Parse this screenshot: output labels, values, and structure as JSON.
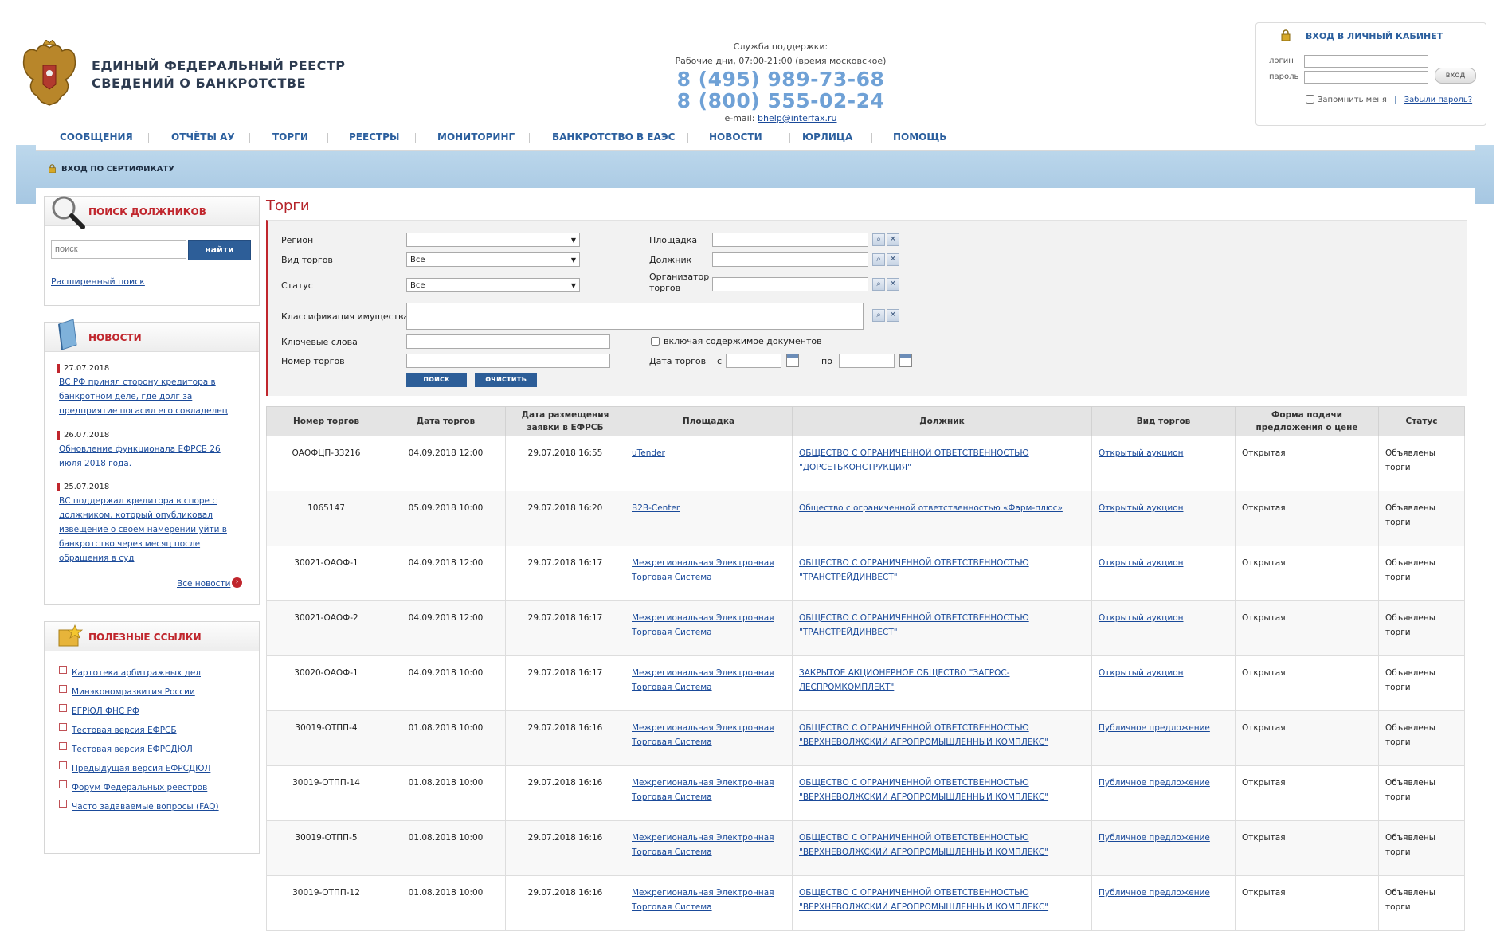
{
  "header": {
    "title_line1": "ЕДИНЫЙ ФЕДЕРАЛЬНЫЙ РЕЕСТР",
    "title_line2": "СВЕДЕНИЙ О БАНКРОТСТВЕ",
    "support_label": "Служба поддержки:",
    "support_hours": "Рабочие дни, 07:00-21:00 (время московское)",
    "phone1": "8 (495) 989-73-68",
    "phone2": "8 (800) 555-02-24",
    "email_label": "e-mail:",
    "email": "bhelp@interfax.ru"
  },
  "login": {
    "title": "ВХОД В ЛИЧНЫЙ КАБИНЕТ",
    "login_label": "логин",
    "password_label": "пароль",
    "submit": "вход",
    "remember": "Запомнить меня",
    "separator": "|",
    "forgot": "Забыли пароль?"
  },
  "nav": {
    "items": [
      "СООБЩЕНИЯ",
      "ОТЧЁТЫ АУ",
      "ТОРГИ",
      "РЕЕСТРЫ",
      "МОНИТОРИНГ",
      "БАНКРОТСТВО В ЕАЭС",
      "НОВОСТИ",
      "ЮРЛИЦА",
      "ПОМОЩЬ"
    ]
  },
  "cert_login": "ВХОД ПО СЕРТИФИКАТУ",
  "sidebar": {
    "search": {
      "title": "ПОИСК ДОЛЖНИКОВ",
      "placeholder": "поиск",
      "button": "найти",
      "advanced": "Расширенный поиск"
    },
    "news": {
      "title": "НОВОСТИ",
      "items": [
        {
          "date": "27.07.2018",
          "text": "ВС РФ принял сторону кредитора в банкротном деле, где долг за предприятие погасил его совладелец"
        },
        {
          "date": "26.07.2018",
          "text": "Обновление функционала ЕФРСБ 26 июля 2018 года."
        },
        {
          "date": "25.07.2018",
          "text": "ВС поддержал кредитора в споре с должником, который опубликовал извещение о своем намерении уйти в банкротство через месяц после обращения в суд"
        }
      ],
      "all": "Все новости"
    },
    "links": {
      "title": "ПОЛЕЗНЫЕ ССЫЛКИ",
      "items": [
        "Картотека арбитражных дел",
        "Минэкономразвития России",
        "ЕГРЮЛ ФНС РФ",
        "Тестовая версия ЕФРСБ",
        "Тестовая версия ЕФРСДЮЛ",
        "Предыдущая версия ЕФРСДЮЛ",
        "Форум Федеральных реестров",
        "Часто задаваемые вопросы (FAQ)"
      ]
    }
  },
  "main": {
    "title": "Торги",
    "filters": {
      "region_label": "Регион",
      "region_value": "",
      "type_label": "Вид торгов",
      "type_value": "Все",
      "status_label": "Статус",
      "status_value": "Все",
      "classification_label": "Классификация имущества",
      "keywords_label": "Ключевые слова",
      "number_label": "Номер торгов",
      "platform_label": "Площадка",
      "debtor_label": "Должник",
      "organizer_label_1": "Организатор",
      "organizer_label_2": "торгов",
      "include_docs": "включая содержимое документов",
      "date_label": "Дата торгов",
      "date_from": "с",
      "date_to": "по",
      "search_btn": "поиск",
      "clear_btn": "очистить"
    },
    "table": {
      "columns": [
        "Номер торгов",
        "Дата торгов",
        "Дата размещения заявки в ЕФРСБ",
        "Площадка",
        "Должник",
        "Вид торгов",
        "Форма подачи предложения о цене",
        "Статус"
      ],
      "rows": [
        [
          "ОАОФЦП-33216",
          "04.09.2018 12:00",
          "29.07.2018 16:55",
          "uTender",
          "ОБЩЕСТВО С ОГРАНИЧЕННОЙ ОТВЕТСТВЕННОСТЬЮ \"ДОРСЕТЬКОНСТРУКЦИЯ\"",
          "Открытый аукцион",
          "Открытая",
          "Объявлены торги"
        ],
        [
          "1065147",
          "05.09.2018 10:00",
          "29.07.2018 16:20",
          "B2B-Center",
          "Общество с ограниченной ответственностью «Фарм-плюс»",
          "Открытый аукцион",
          "Открытая",
          "Объявлены торги"
        ],
        [
          "30021-ОАОФ-1",
          "04.09.2018 12:00",
          "29.07.2018 16:17",
          "Межрегиональная Электронная Торговая Система",
          "ОБЩЕСТВО С ОГРАНИЧЕННОЙ ОТВЕТСТВЕННОСТЬЮ \"ТРАНСТРЕЙДИНВЕСТ\"",
          "Открытый аукцион",
          "Открытая",
          "Объявлены торги"
        ],
        [
          "30021-ОАОФ-2",
          "04.09.2018 12:00",
          "29.07.2018 16:17",
          "Межрегиональная Электронная Торговая Система",
          "ОБЩЕСТВО С ОГРАНИЧЕННОЙ ОТВЕТСТВЕННОСТЬЮ \"ТРАНСТРЕЙДИНВЕСТ\"",
          "Открытый аукцион",
          "Открытая",
          "Объявлены торги"
        ],
        [
          "30020-ОАОФ-1",
          "04.09.2018 10:00",
          "29.07.2018 16:17",
          "Межрегиональная Электронная Торговая Система",
          "ЗАКРЫТОЕ АКЦИОНЕРНОЕ ОБЩЕСТВО \"ЗАГРОС-ЛЕСПРОМКОМПЛЕКТ\"",
          "Открытый аукцион",
          "Открытая",
          "Объявлены торги"
        ],
        [
          "30019-ОТПП-4",
          "01.08.2018 10:00",
          "29.07.2018 16:16",
          "Межрегиональная Электронная Торговая Система",
          "ОБЩЕСТВО С ОГРАНИЧЕННОЙ ОТВЕТСТВЕННОСТЬЮ \"ВЕРХНЕВОЛЖСКИЙ АГРОПРОМЫШЛЕННЫЙ КОМПЛЕКС\"",
          "Публичное предложение",
          "Открытая",
          "Объявлены торги"
        ],
        [
          "30019-ОТПП-14",
          "01.08.2018 10:00",
          "29.07.2018 16:16",
          "Межрегиональная Электронная Торговая Система",
          "ОБЩЕСТВО С ОГРАНИЧЕННОЙ ОТВЕТСТВЕННОСТЬЮ \"ВЕРХНЕВОЛЖСКИЙ АГРОПРОМЫШЛЕННЫЙ КОМПЛЕКС\"",
          "Публичное предложение",
          "Открытая",
          "Объявлены торги"
        ],
        [
          "30019-ОТПП-5",
          "01.08.2018 10:00",
          "29.07.2018 16:16",
          "Межрегиональная Электронная Торговая Система",
          "ОБЩЕСТВО С ОГРАНИЧЕННОЙ ОТВЕТСТВЕННОСТЬЮ \"ВЕРХНЕВОЛЖСКИЙ АГРОПРОМЫШЛЕННЫЙ КОМПЛЕКС\"",
          "Публичное предложение",
          "Открытая",
          "Объявлены торги"
        ],
        [
          "30019-ОТПП-12",
          "01.08.2018 10:00",
          "29.07.2018 16:16",
          "Межрегиональная Электронная Торговая Система",
          "ОБЩЕСТВО С ОГРАНИЧЕННОЙ ОТВЕТСТВЕННОСТЬЮ \"ВЕРХНЕВОЛЖСКИЙ АГРОПРОМЫШЛЕННЫЙ КОМПЛЕКС\"",
          "Публичное предложение",
          "Открытая",
          "Объявлены торги"
        ]
      ]
    }
  },
  "colors": {
    "accent_red": "#c0262d",
    "nav_blue": "#2b5f9e",
    "phone_blue": "#6fa1d6",
    "button_blue": "#2d5e98"
  },
  "icons": {
    "emblem": "double-headed-eagle-emblem",
    "lock": "lock-icon",
    "search": "magnifier-icon",
    "news": "book-icon",
    "links": "folder-star-icon",
    "calendar": "calendar-icon"
  }
}
